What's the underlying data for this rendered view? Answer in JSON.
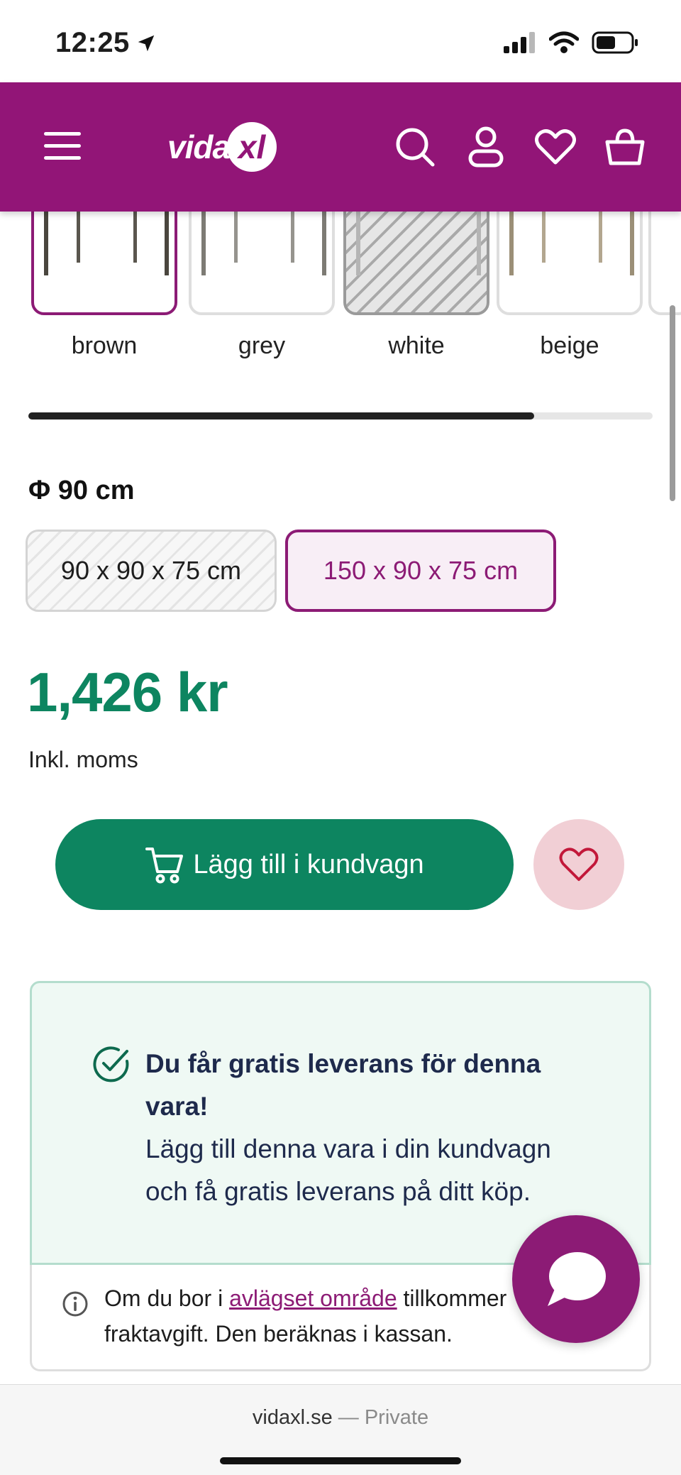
{
  "status_bar": {
    "time": "12:25",
    "icons": [
      "location-arrow-icon",
      "cellular-signal-icon",
      "wifi-icon",
      "battery-icon"
    ]
  },
  "header": {
    "logo_text": "vida",
    "logo_mark": "xl",
    "background_color": "#921577",
    "icons": [
      "menu-icon",
      "search-icon",
      "account-icon",
      "wishlist-icon",
      "basket-icon"
    ]
  },
  "color_options": {
    "items": [
      {
        "label": "brown",
        "selected": true,
        "available": true
      },
      {
        "label": "grey",
        "selected": false,
        "available": true
      },
      {
        "label": "white",
        "selected": false,
        "available": false
      },
      {
        "label": "beige",
        "selected": false,
        "available": true
      }
    ],
    "scroll_progress": 0.81
  },
  "size": {
    "label": "Φ 90 cm",
    "options": [
      {
        "label": "90 x 90 x 75 cm",
        "selected": false,
        "available": false
      },
      {
        "label": "150 x 90 x 75 cm",
        "selected": true,
        "available": true
      }
    ]
  },
  "price": {
    "amount": "1,426 kr",
    "vat_note": "Inkl. moms",
    "color": "#0d8560"
  },
  "actions": {
    "add_to_cart": "Lägg till i kundvagn"
  },
  "delivery": {
    "title": "Du får gratis leverans för denna vara!",
    "text": "Lägg till denna vara i din kundvagn och få gratis leverans på ditt köp."
  },
  "info": {
    "prefix": "Om du bor i ",
    "link": "avlägset område",
    "suffix": " tillkommer fraktavgift. Den beräknas i kassan."
  },
  "browser": {
    "domain": "vidaxl.se",
    "separator": " — ",
    "mode": "Private"
  },
  "colors": {
    "brand_purple": "#921577",
    "accent_green": "#0d8560"
  }
}
